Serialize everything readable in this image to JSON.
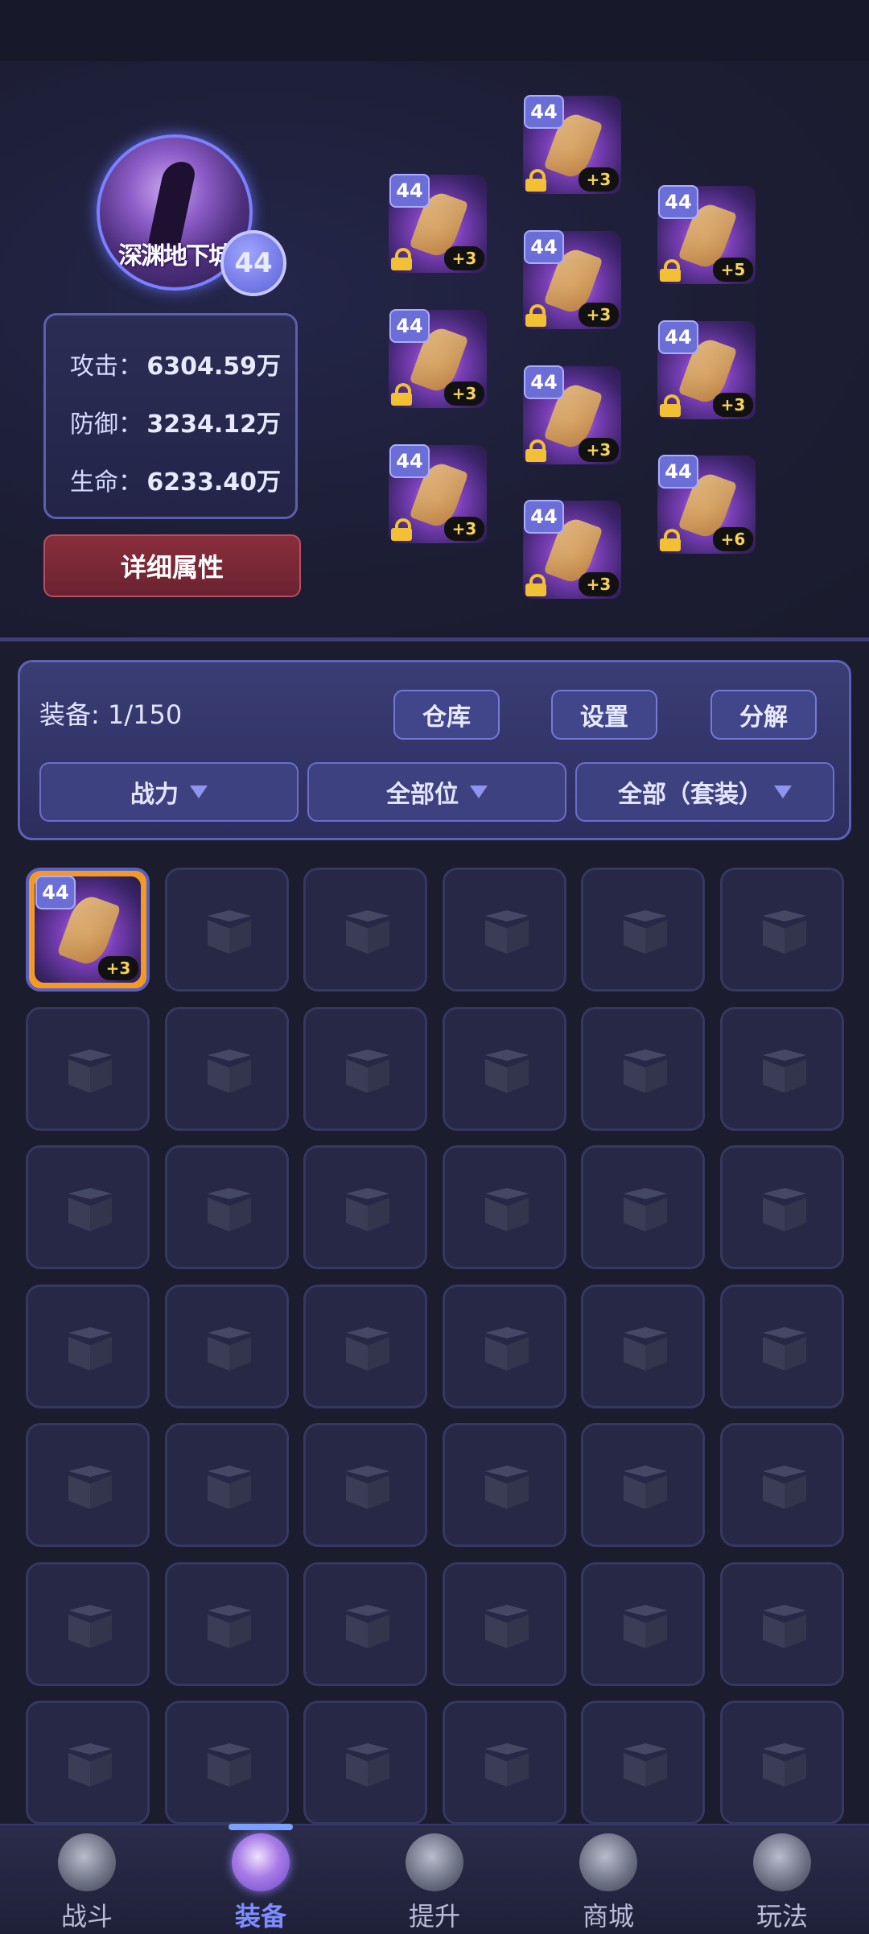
{
  "profile": {
    "avatar_text": "深渊地下城",
    "level": "44"
  },
  "stats": [
    {
      "label": "攻击：",
      "value": "6304.59万"
    },
    {
      "label": "防御：",
      "value": "3234.12万"
    },
    {
      "label": "生命：",
      "value": "6233.40万"
    }
  ],
  "detail_button": "详细属性",
  "equipped": [
    {
      "level": "44",
      "plus": "+3",
      "rarity": "orange"
    },
    {
      "level": "44",
      "plus": "+3",
      "rarity": "red"
    },
    {
      "level": "44",
      "plus": "+3",
      "rarity": "red"
    },
    {
      "level": "44",
      "plus": "+3",
      "rarity": "red"
    },
    {
      "level": "44",
      "plus": "+3",
      "rarity": "orange"
    },
    {
      "level": "44",
      "plus": "+3",
      "rarity": "red"
    },
    {
      "level": "44",
      "plus": "+3",
      "rarity": "red"
    },
    {
      "level": "44",
      "plus": "+5",
      "rarity": "red"
    },
    {
      "level": "44",
      "plus": "+3",
      "rarity": "red"
    },
    {
      "level": "44",
      "plus": "+6",
      "rarity": "red"
    }
  ],
  "inventory_header": {
    "count": "装备: 1/150",
    "buttons": [
      "仓库",
      "设置",
      "分解"
    ],
    "filters": [
      "战力",
      "全部位",
      "全部（套装）"
    ]
  },
  "inventory": {
    "items": [
      {
        "level": "44",
        "plus": "+3"
      }
    ]
  },
  "nav": [
    {
      "label": "战斗",
      "icon": "battle-icon"
    },
    {
      "label": "装备",
      "icon": "equipment-icon",
      "active": true
    },
    {
      "label": "提升",
      "icon": "upgrade-icon"
    },
    {
      "label": "商城",
      "icon": "shop-icon"
    },
    {
      "label": "玩法",
      "icon": "gameplay-icon"
    }
  ],
  "colors": {
    "red_frame": "#d32a3a",
    "orange_frame": "#f29a25",
    "accent": "#7d8dff"
  }
}
